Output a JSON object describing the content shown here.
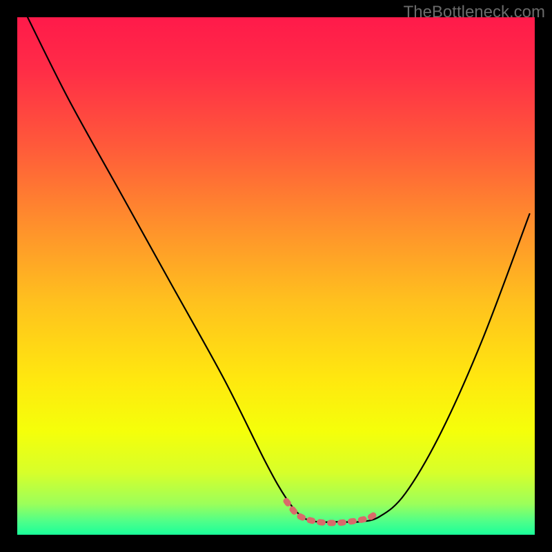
{
  "attribution": "TheBottleneck.com",
  "gradient_stops": [
    {
      "offset": 0.0,
      "color": "#ff1a4a"
    },
    {
      "offset": 0.1,
      "color": "#ff2c47"
    },
    {
      "offset": 0.25,
      "color": "#ff5a3a"
    },
    {
      "offset": 0.4,
      "color": "#ff8f2c"
    },
    {
      "offset": 0.55,
      "color": "#ffc11e"
    },
    {
      "offset": 0.7,
      "color": "#ffe80f"
    },
    {
      "offset": 0.8,
      "color": "#f5ff0a"
    },
    {
      "offset": 0.88,
      "color": "#d7ff2a"
    },
    {
      "offset": 0.94,
      "color": "#9cff5a"
    },
    {
      "offset": 0.975,
      "color": "#4dff8a"
    },
    {
      "offset": 1.0,
      "color": "#1aff9a"
    }
  ],
  "chart_data": {
    "type": "line",
    "title": "",
    "xlabel": "",
    "ylabel": "",
    "xlim": [
      0,
      100
    ],
    "ylim": [
      0,
      100
    ],
    "grid": false,
    "series": [
      {
        "name": "bottleneck-curve",
        "color": "#000000",
        "x": [
          2,
          10,
          20,
          30,
          40,
          48,
          52,
          55,
          58,
          62,
          66,
          70,
          75,
          82,
          90,
          99
        ],
        "values": [
          100,
          84,
          66,
          48,
          30,
          14,
          7,
          3.5,
          2.5,
          2.5,
          2.5,
          3.5,
          8,
          20,
          38,
          62
        ]
      },
      {
        "name": "optimum-band",
        "color": "#d96a6a",
        "x": [
          52,
          54,
          56,
          58,
          60,
          62,
          64,
          66,
          68,
          70
        ],
        "values": [
          6.5,
          4.0,
          3.0,
          2.5,
          2.3,
          2.3,
          2.5,
          2.8,
          3.3,
          4.5
        ]
      }
    ],
    "annotations": []
  }
}
